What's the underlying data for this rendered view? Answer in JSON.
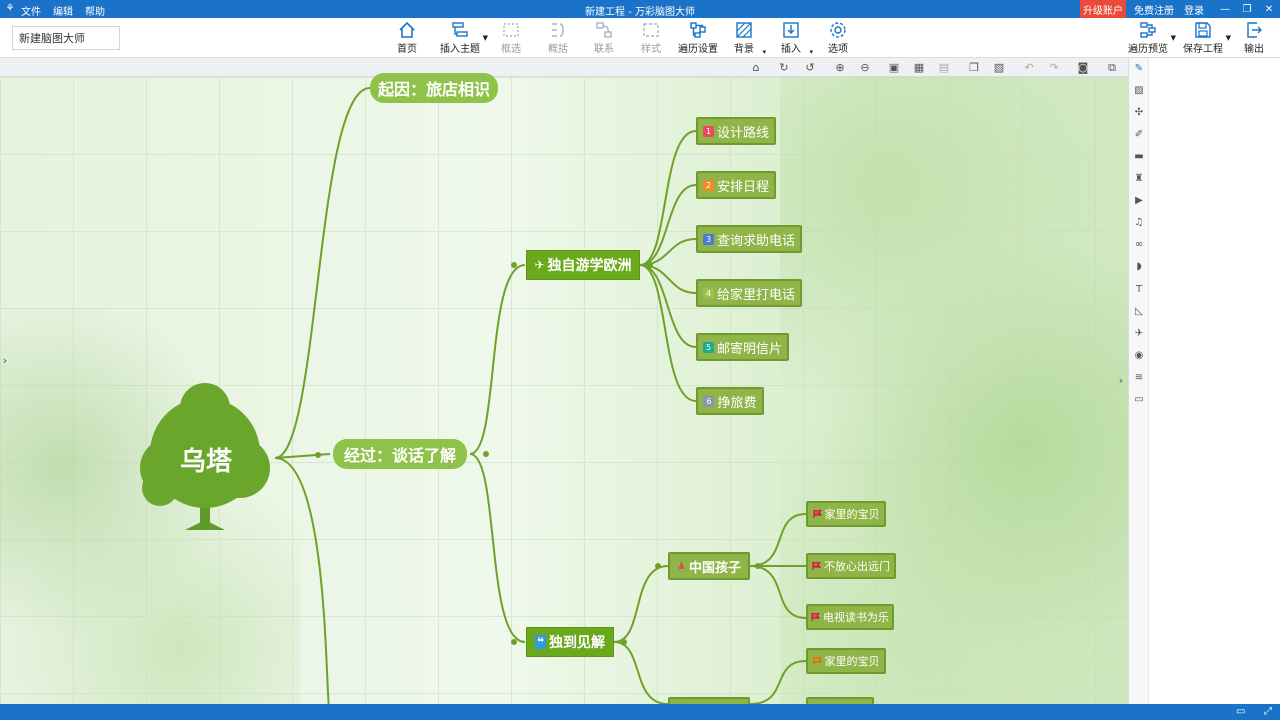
{
  "titlebar": {
    "app_icon": "tree-logo-icon",
    "menu": [
      "文件",
      "编辑",
      "帮助"
    ],
    "title": "新建工程 - 万彩脑图大师",
    "upgrade": "升级账户",
    "register": "免费注册",
    "login": "登录",
    "window_controls": [
      "minimize-icon",
      "restore-icon",
      "close-icon"
    ]
  },
  "toolbar": {
    "doc_name": "新建脑图大师",
    "buttons": {
      "home": "首页",
      "insert_topic": "插入主题",
      "select": "框选",
      "summary": "概括",
      "relation": "联系",
      "style": "样式",
      "tour_settings": "遍历设置",
      "background": "背景",
      "insert": "插入",
      "options": "选项",
      "tour_preview": "遍历预览",
      "save_project": "保存工程",
      "export": "输出"
    }
  },
  "canvas_tools": [
    "home-icon",
    "redo-icon",
    "undo-alt-icon",
    "zoom-in-icon",
    "zoom-out-icon",
    "lock-icon",
    "grid-icon",
    "grid-alt-icon",
    "copy-icon",
    "paste-icon",
    "undo-icon",
    "redo-arrow-icon",
    "camera-icon",
    "window-icon"
  ],
  "mindmap": {
    "root": "乌塔",
    "branches": [
      {
        "label": "起因：旅店相识"
      },
      {
        "label": "经过：谈话了解"
      },
      {
        "label": "独自游学欧洲",
        "icon": "airplane-icon",
        "children": [
          {
            "num": "1",
            "color": "#e84a5f",
            "label": "设计路线"
          },
          {
            "num": "2",
            "color": "#f08a24",
            "label": "安排日程"
          },
          {
            "num": "3",
            "color": "#4a7bd0",
            "label": "查询求助电话"
          },
          {
            "num": "4",
            "color": "#9ac24b",
            "label": "给家里打电话"
          },
          {
            "num": "5",
            "color": "#1fa98c",
            "label": "邮寄明信片"
          },
          {
            "num": "6",
            "color": "#8a97a8",
            "label": "挣旅费"
          }
        ]
      },
      {
        "label": "独到见解",
        "icon": "quote-icon",
        "children": [
          {
            "label": "中国孩子",
            "icon": "person-icon",
            "children": [
              {
                "label": "家里的宝贝"
              },
              {
                "label": "不放心出远门"
              },
              {
                "label": "电视读书为乐"
              }
            ]
          },
          {
            "label": "",
            "children": [
              {
                "label": "家里的宝贝"
              },
              {
                "label": ""
              }
            ]
          }
        ]
      }
    ]
  },
  "right_panel_icons": [
    "edit-icon",
    "image-icon",
    "puzzle-icon",
    "pen-icon",
    "comment-icon",
    "shirt-icon",
    "video-icon",
    "music-icon",
    "link-icon",
    "tag-icon",
    "text-icon",
    "chart-icon",
    "plane-icon",
    "compass-icon",
    "layers-icon",
    "box-icon"
  ],
  "statusbar": {
    "icons": [
      "monitor-icon",
      "fullscreen-icon"
    ]
  }
}
